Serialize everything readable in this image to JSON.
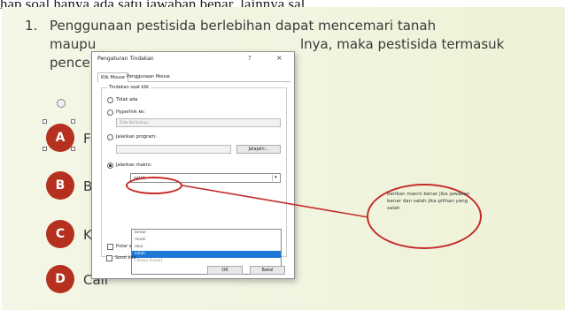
{
  "page": {
    "top_text": "hap soal hanya ada satu jawaban benar, lainnya sal"
  },
  "question": {
    "number": "1.",
    "line1": "Penggunaan pestisida berlebihan dapat mencemari tanah",
    "line2_a": "maupu",
    "line2_b": "lnya, maka pestisida termasuk",
    "line3": "pence"
  },
  "options": [
    {
      "letter": "A",
      "label": "Fis"
    },
    {
      "letter": "B",
      "label": "Bic"
    },
    {
      "letter": "C",
      "label": "Kir"
    },
    {
      "letter": "D",
      "label": "Cair"
    }
  ],
  "dialog": {
    "title": "Pengaturan Tindakan",
    "help": "?",
    "close": "×",
    "tabs": [
      "Klik Mouse",
      "Penggunaan Mouse"
    ],
    "group_title": "Tindakan saat klik",
    "radios": [
      {
        "label": "Tidak ada",
        "checked": false
      },
      {
        "label": "Hyperlink ke:",
        "checked": false
      },
      {
        "label": "Jalankan program:",
        "checked": false
      },
      {
        "label": "Jalankan makro:",
        "checked": true
      }
    ],
    "hyperlink_value": "Slide Berikutnya",
    "browse_button": "Jelajahi...",
    "macro_value": "salah",
    "macro_options": [
      "benar",
      "mulai",
      "akui",
      "salah"
    ],
    "sound_checkbox": "Putar suara:",
    "sound_value": "[Tanpa Suara]",
    "highlight_checkbox": "Sorot klik",
    "ok_button": "OK",
    "cancel_button": "Batal"
  },
  "annotation": {
    "text": "berikan macro benar jika jawaban benar dan salah jika pilihan yang salah"
  },
  "colors": {
    "option_circle": "#b5301f",
    "annotation_stroke": "#c42a2a",
    "selection_blue": "#1e78d6"
  }
}
